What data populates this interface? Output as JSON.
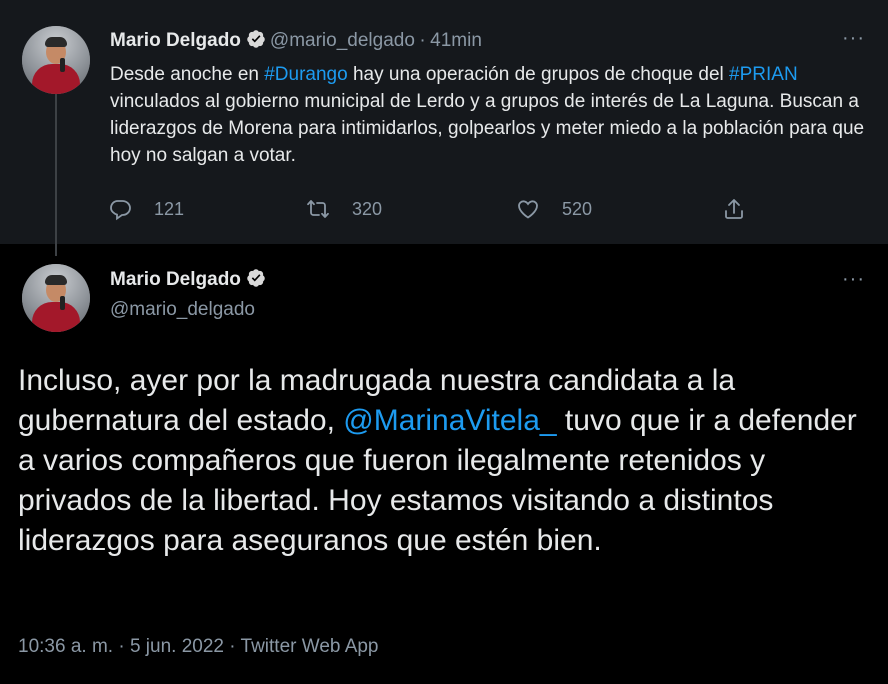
{
  "parent_tweet": {
    "author_name": "Mario Delgado",
    "handle": "@mario_delgado",
    "separator": "·",
    "time": "41min",
    "more": "···",
    "text_parts": {
      "t1": "Desde anoche en ",
      "hashtag1": "#Durango",
      "t2": " hay una operación de grupos de choque del ",
      "hashtag2": "#PRIAN",
      "t3": " vinculados al gobierno municipal de Lerdo y a grupos de interés de La Laguna. Buscan a liderazgos de Morena para intimidarlos, golpearlos y meter miedo a la población para que hoy no salgan a votar."
    },
    "replies": "121",
    "retweets": "320",
    "likes": "520"
  },
  "main_tweet": {
    "author_name": "Mario Delgado",
    "handle": "@mario_delgado",
    "more": "···",
    "text_parts": {
      "t1": "Incluso, ayer por la madrugada nuestra candidata a la gubernatura del estado, ",
      "mention": "@MarinaVitela_",
      "t2": " tuvo que ir a defender a varios compañeros que fueron ilegalmente retenidos y privados de la libertad. Hoy estamos visitando a distintos liderazgos para aseguranos que estén bien."
    },
    "meta": "10:36 a. m. · 5 jun. 2022 · Twitter Web App"
  },
  "colors": {
    "link": "#1d9bf0",
    "verified": "#d9d9d9",
    "muted": "#8b98a5"
  },
  "icons": [
    "verified-badge-icon",
    "reply-icon",
    "retweet-icon",
    "like-icon",
    "share-icon",
    "more-icon"
  ]
}
